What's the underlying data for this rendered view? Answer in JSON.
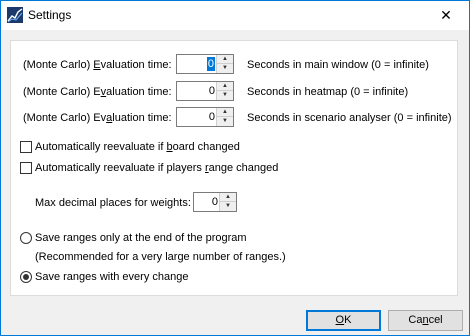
{
  "window": {
    "title": "Settings",
    "close_glyph": "✕"
  },
  "evaluation": [
    {
      "label_pre": "(Monte Carlo) ",
      "label_acc": "E",
      "label_post": "valuation time:",
      "value": "0",
      "selected": true,
      "hint": "Seconds in main window (0 = infinite)"
    },
    {
      "label_pre": "(Monte Carlo) E",
      "label_acc": "v",
      "label_post": "aluation time:",
      "value": "0",
      "selected": false,
      "hint": "Seconds in heatmap (0 = infinite)"
    },
    {
      "label_pre": "(Monte Carlo) Ev",
      "label_acc": "a",
      "label_post": "luation time:",
      "value": "0",
      "selected": false,
      "hint": "Seconds in scenario analyser (0 = infinite)"
    }
  ],
  "checks": [
    {
      "pre": "Automatically reevaluate if ",
      "acc": "b",
      "post": "oard changed",
      "checked": false
    },
    {
      "pre": "Automatically reevaluate if players ",
      "acc": "r",
      "post": "ange changed",
      "checked": false
    }
  ],
  "decimals": {
    "label": "Max decimal places for weights:",
    "value": "0"
  },
  "radios": [
    {
      "label": "Save ranges only at the end of the program",
      "note": "(Recommended for a very large number of ranges.)",
      "checked": false
    },
    {
      "label": "Save ranges with every change",
      "note": "",
      "checked": true
    }
  ],
  "buttons": {
    "ok": {
      "acc": "O",
      "rest": "K"
    },
    "cancel": {
      "pre": "Ca",
      "acc": "n",
      "post": "cel"
    }
  }
}
